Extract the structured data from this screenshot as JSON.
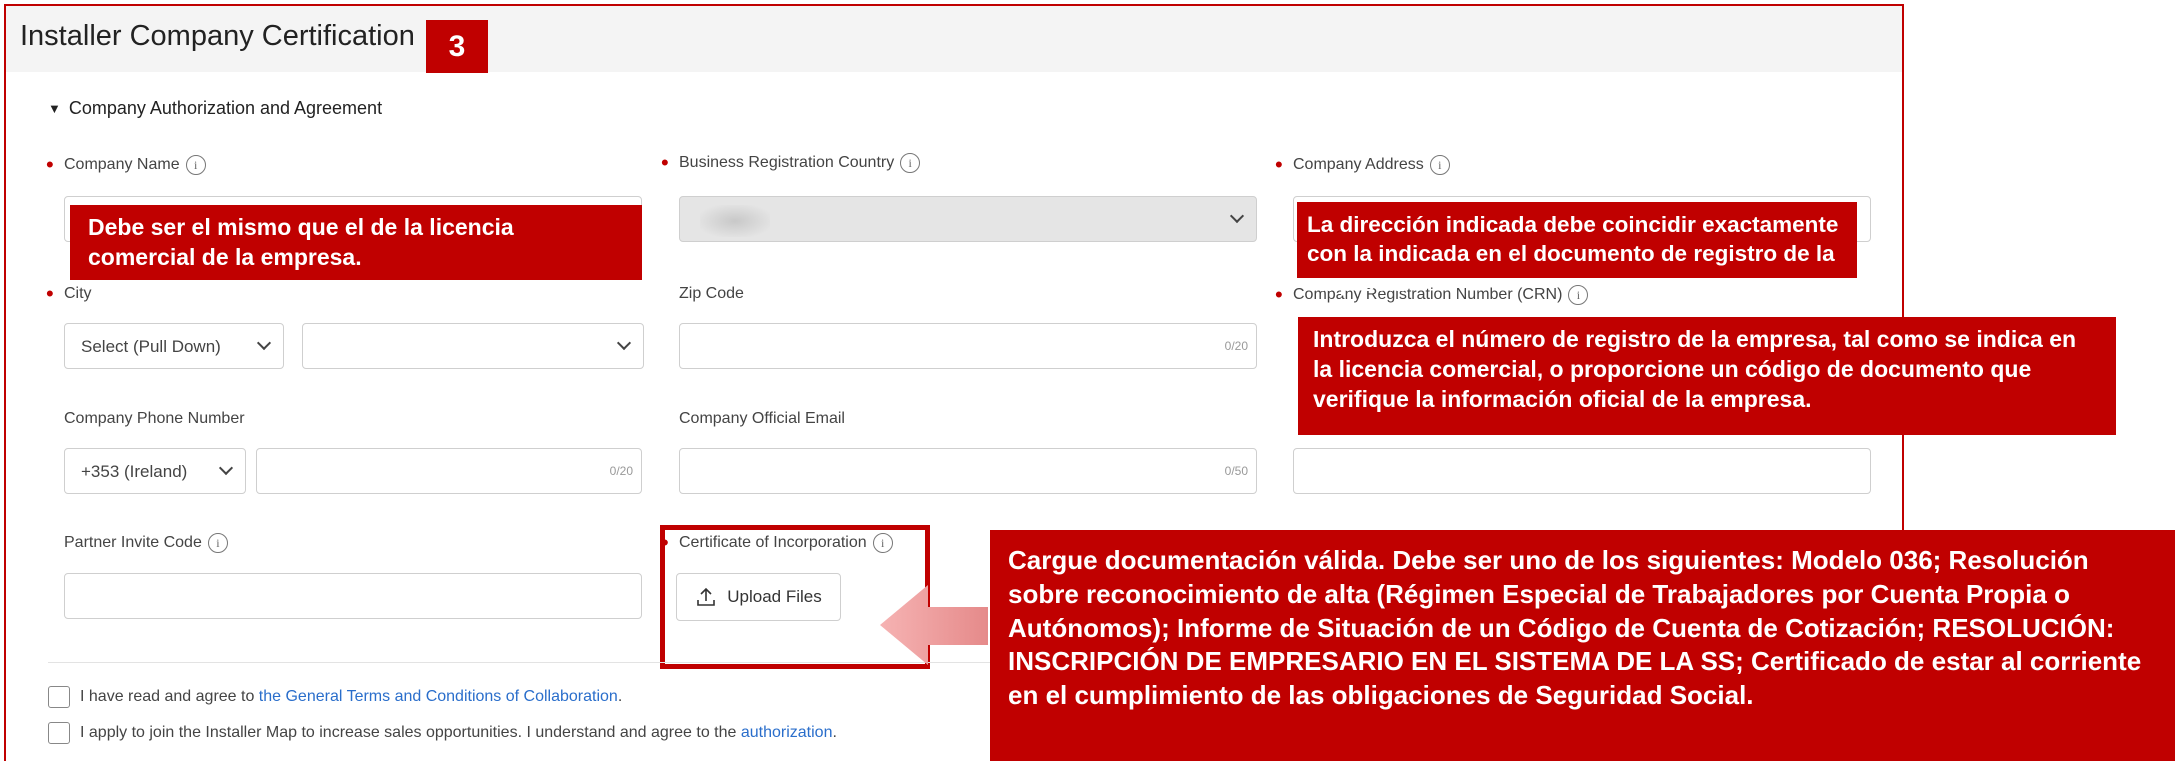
{
  "header": {
    "title": "Installer Company Certification",
    "step_badge": "3"
  },
  "section": {
    "title": "Company Authorization and Agreement"
  },
  "fields": {
    "company_name": {
      "label": "Company Name"
    },
    "business_country": {
      "label": "Business Registration Country"
    },
    "company_address": {
      "label": "Company Address"
    },
    "city": {
      "label": "City",
      "select1_value": "Select (Pull Down)"
    },
    "zip_code": {
      "label": "Zip Code",
      "counter": "0/20"
    },
    "crn": {
      "label": "Company Registration Number (CRN)"
    },
    "phone": {
      "label": "Company Phone Number",
      "country_code": "+353 (Ireland)",
      "counter": "0/20"
    },
    "email": {
      "label": "Company Official Email",
      "counter": "0/50"
    },
    "partner_code": {
      "label": "Partner Invite Code"
    },
    "certificate": {
      "label": "Certificate of Incorporation",
      "upload_label": "Upload Files"
    }
  },
  "agreements": {
    "terms_prefix": "I have read and agree to ",
    "terms_link": "the General Terms and Conditions of Collaboration",
    "terms_suffix": ".",
    "map_prefix": "I apply to join the Installer Map to increase sales opportunities. I understand and agree to the ",
    "map_link": "authorization",
    "map_suffix": "."
  },
  "callouts": {
    "company_name": "Debe ser el mismo que el de la licencia comercial de la empresa.",
    "address": "La dirección indicada debe coincidir exactamente con la indicada en el documento de registro de la empresa.",
    "crn": "Introduzca el número de registro de la empresa, tal como se indica en la licencia comercial, o proporcione un código de documento que verifique la información oficial de la empresa.",
    "certificate": "Cargue documentación válida. Debe ser uno de los siguientes: Modelo 036; Resolución sobre reconocimiento de alta (Régimen Especial de Trabajadores por Cuenta Propia o Autónomos); Informe de Situación de un Código de Cuenta de Cotización; RESOLUCIÓN: INSCRIPCIÓN DE EMPRESARIO EN EL SISTEMA DE LA SS; Certificado de estar al corriente en el cumplimiento de las obligaciones de Seguridad Social."
  },
  "colors": {
    "accent_red": "#c00000",
    "link_blue": "#2a6ecb"
  }
}
